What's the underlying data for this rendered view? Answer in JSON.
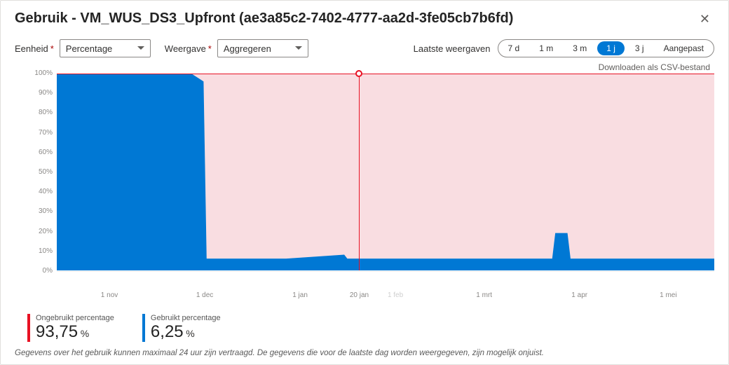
{
  "header": {
    "title": "Gebruik - VM_WUS_DS3_Upfront (ae3a85c2-7402-4777-aa2d-3fe05cb7b6fd)"
  },
  "controls": {
    "eenheid_label": "Eenheid",
    "eenheid_value": "Percentage",
    "weergave_label": "Weergave",
    "weergave_value": "Aggregeren",
    "laatste_label": "Laatste weergaven",
    "ranges": [
      "7 d",
      "1 m",
      "3 m",
      "1 j",
      "3 j",
      "Aangepast"
    ],
    "active_range_index": 3,
    "csv_link": "Downloaden als CSV-bestand"
  },
  "legend": {
    "unused": "ONGEBRUIKT PERCENTAGE",
    "used": "GEBRUIKT PERCENTAGE"
  },
  "axes": {
    "y_labels": [
      "100%",
      "90%",
      "80%",
      "70%",
      "60%",
      "50%",
      "40%",
      "30%",
      "20%",
      "10%",
      "0%"
    ],
    "x_labels": [
      {
        "text": "1 nov",
        "pos": 8,
        "faded": false
      },
      {
        "text": "1 dec",
        "pos": 22.5,
        "faded": false
      },
      {
        "text": "1 jan",
        "pos": 37,
        "faded": false
      },
      {
        "text": "20 jan",
        "pos": 46,
        "faded": false
      },
      {
        "text": "1 feb",
        "pos": 51.5,
        "faded": true
      },
      {
        "text": "1 mrt",
        "pos": 65,
        "faded": false
      },
      {
        "text": "1 apr",
        "pos": 79.5,
        "faded": false
      },
      {
        "text": "1 mei",
        "pos": 93,
        "faded": false
      }
    ]
  },
  "marker": {
    "x_percent": 46
  },
  "stats": {
    "unused_label": "Ongebruikt percentage",
    "unused_value": "93,75",
    "used_label": "Gebruikt percentage",
    "used_value": "6,25",
    "unit": "%"
  },
  "footnote": "Gegevens over het gebruik kunnen maximaal 24 uur zijn vertraagd. De gegevens die voor de laatste dag worden weergegeven, zijn mogelijk onjuist.",
  "colors": {
    "unused": "#e81123",
    "used": "#0078d4",
    "unused_fill": "#f9dde1"
  },
  "chart_data": {
    "type": "area",
    "title": "Gebruik - VM_WUS_DS3_Upfront",
    "ylabel": "Percentage",
    "ylim": [
      0,
      100
    ],
    "x": [
      "2023-10-18",
      "2023-11-01",
      "2023-12-01",
      "2023-12-05",
      "2023-12-06",
      "2024-01-01",
      "2024-01-20",
      "2024-01-21",
      "2024-02-01",
      "2024-03-01",
      "2024-03-28",
      "2024-03-29",
      "2024-04-02",
      "2024-04-03",
      "2024-05-01",
      "2024-05-20"
    ],
    "series": [
      {
        "name": "GEBRUIKT PERCENTAGE",
        "color": "#0078d4",
        "values": [
          100,
          100,
          100,
          96,
          6,
          6,
          8,
          6,
          6,
          6,
          6,
          19,
          19,
          6,
          6,
          6
        ]
      },
      {
        "name": "ONGEBRUIKT PERCENTAGE",
        "color": "#e81123",
        "values": [
          0,
          0,
          0,
          4,
          94,
          94,
          92,
          94,
          94,
          94,
          94,
          81,
          81,
          94,
          94,
          94
        ]
      }
    ],
    "stack": true,
    "annotations": [
      {
        "type": "vline",
        "x": "2024-01-20",
        "label": "20 jan"
      }
    ]
  }
}
